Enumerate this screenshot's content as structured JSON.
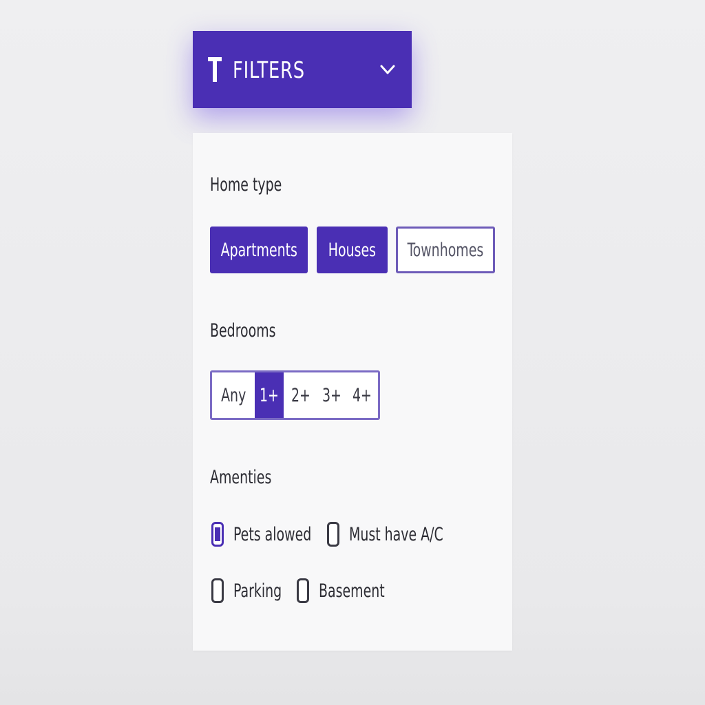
{
  "header": {
    "title": "FILTERS",
    "icon": "funnel-icon",
    "chevron": "chevron-down-icon"
  },
  "home_type": {
    "label": "Home type",
    "options": [
      {
        "label": "Apartments",
        "selected": true
      },
      {
        "label": "Houses",
        "selected": true
      },
      {
        "label": "Townhomes",
        "selected": false
      }
    ]
  },
  "bedrooms": {
    "label": "Bedrooms",
    "options": [
      "Any",
      "1+",
      "2+",
      "3+",
      "4+"
    ],
    "selected": "1+"
  },
  "amenities": {
    "label": "Amenties",
    "items": [
      {
        "label": "Pets alowed",
        "checked": true
      },
      {
        "label": "Must have A/C",
        "checked": false
      },
      {
        "label": "Parking",
        "checked": false
      },
      {
        "label": "Basement",
        "checked": false
      }
    ]
  },
  "colors": {
    "accent": "#4a2fb4",
    "panel_bg": "#f8f8f9",
    "page_bg": "#ececee"
  }
}
